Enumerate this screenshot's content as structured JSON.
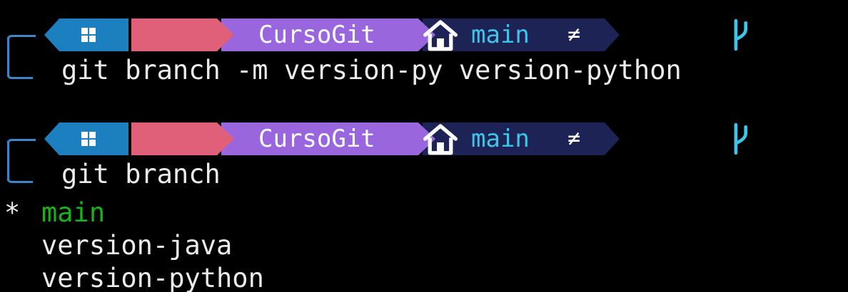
{
  "prompts": [
    {
      "folder": "CursoGit",
      "branch": "main",
      "status": "≠",
      "command": "git branch -m version-py version-python"
    },
    {
      "folder": "CursoGit",
      "branch": "main",
      "status": "≠",
      "command": "git branch"
    }
  ],
  "output": {
    "current_marker": "*",
    "branches": [
      {
        "name": "main",
        "current": true
      },
      {
        "name": "version-java",
        "current": false
      },
      {
        "name": "version-python",
        "current": false
      }
    ]
  },
  "icons": {
    "os_segment": "windows-icon",
    "home_segment": "home-icon",
    "branch_segment": "git-branch-icon"
  },
  "colors": {
    "background": "#000000",
    "os_segment": "#1c7fc0",
    "home_segment": "#e0607a",
    "folder_segment": "#9966dd",
    "git_segment": "#1d2455",
    "branch_text": "#3ec6ea",
    "current_branch": "#19b319",
    "bracket": "#3a86c8",
    "text": "#ececec"
  }
}
